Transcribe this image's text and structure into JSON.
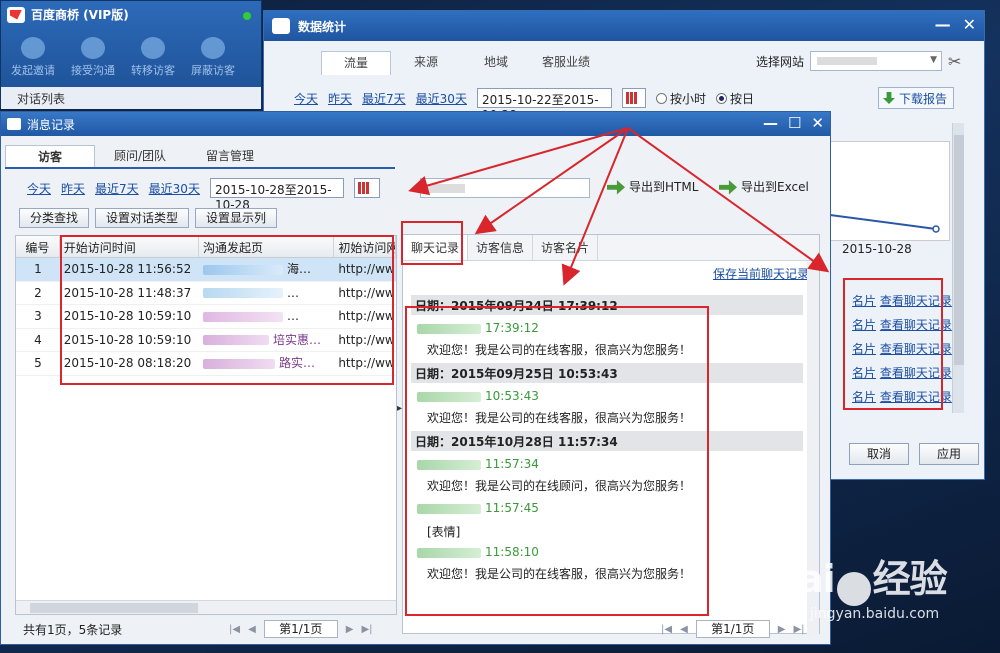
{
  "bq_window": {
    "title": "百度商桥 (VIP版)",
    "tools": [
      "发起邀请",
      "接受沟通",
      "转移访客",
      "屏蔽访客"
    ],
    "list_label": "对话列表"
  },
  "stats_window": {
    "title": "数据统计",
    "tabs": [
      "流量",
      "来源",
      "地域",
      "客服业绩"
    ],
    "site_label": "选择网站",
    "quick_ranges": [
      "今天",
      "昨天",
      "最近7天",
      "最近30天"
    ],
    "date_range": "2015-10-22至2015-10-28",
    "radio_hour": "按小时",
    "radio_day": "按日",
    "download": "下载报告",
    "x_tick": "2015-10-28",
    "row_fragment": "名片",
    "row_links": [
      "查看聊天记录",
      "查看聊天记录",
      "查看聊天记录",
      "查看聊天记录",
      "查看聊天记录"
    ],
    "cancel": "取消",
    "apply": "应用"
  },
  "msg_window": {
    "title": "消息记录",
    "tabs": [
      "访客",
      "顾问/团队",
      "留言管理"
    ],
    "quick_ranges": [
      "今天",
      "昨天",
      "最近7天",
      "最近30天"
    ],
    "date_range": "2015-10-28至2015-10-28",
    "export_html": "导出到HTML",
    "export_excel": "导出到Excel",
    "buttons": [
      "分类查找",
      "设置对话类型",
      "设置显示列"
    ],
    "columns": [
      "编号",
      "开始访问时间",
      "沟通发起页",
      "初始访问网"
    ],
    "rows": [
      {
        "id": "1",
        "time": "2015-10-28 11:56:52",
        "page_tail": "海…",
        "url": "http://ww"
      },
      {
        "id": "2",
        "time": "2015-10-28 11:48:37",
        "page_tail": "…",
        "url": "http://ww"
      },
      {
        "id": "3",
        "time": "2015-10-28 10:59:10",
        "page_tail": "…",
        "url": "http://ww"
      },
      {
        "id": "4",
        "time": "2015-10-28 10:59:10",
        "page_tail": "培实惠…",
        "url": "http://ww"
      },
      {
        "id": "5",
        "time": "2015-10-28 08:18:20",
        "page_tail": "路实…",
        "url": "http://ww"
      }
    ],
    "total": "共有1页，5条记录",
    "page": "第1/1页",
    "chat_tabs": [
      "聊天记录",
      "访客信息",
      "访客名片"
    ],
    "save_chat": "保存当前聊天记录",
    "chat": {
      "d1": "日期：2015年09月24日 17:39:12",
      "t1": "17:39:12",
      "m1": "欢迎您！我是公司的在线客服，很高兴为您服务！",
      "d2": "日期：2015年09月25日 10:53:43",
      "t2": "10:53:43",
      "m2": "欢迎您！我是公司的在线客服，很高兴为您服务！",
      "d3": "日期：2015年10月28日 11:57:34",
      "t3": "11:57:34",
      "m3": "欢迎您！我是公司的在线顾问，很高兴为您服务！",
      "t4": "11:57:45",
      "m4": "[表情]",
      "t5": "11:58:10",
      "m5": "欢迎您！我是公司的在线客服，很高兴为您服务！"
    }
  },
  "watermark": {
    "brand_a": "Bai",
    "brand_b": "经验",
    "url": "jingyan.baidu.com"
  }
}
